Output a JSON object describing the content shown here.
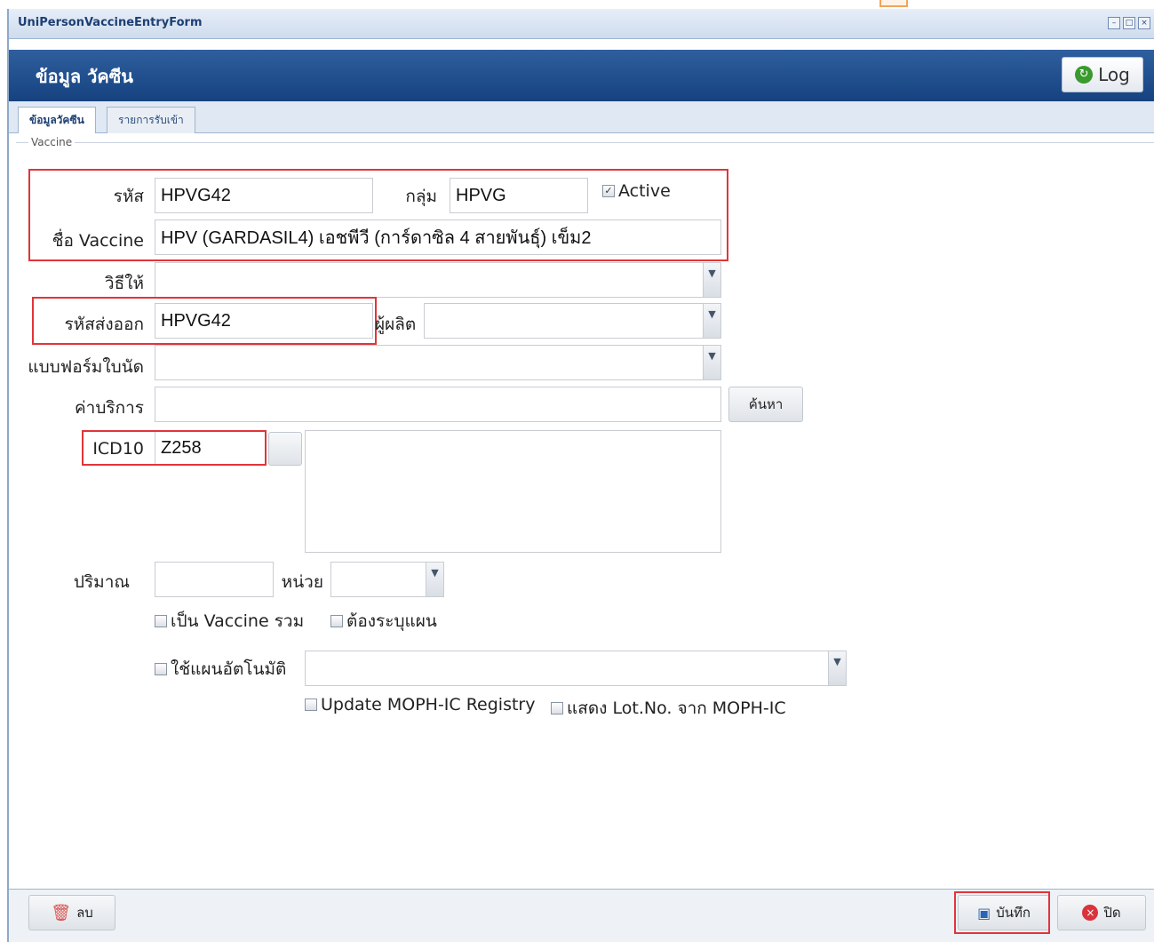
{
  "window": {
    "title": "UniPersonVaccineEntryForm"
  },
  "header": {
    "title": "ข้อมูล วัคซีน",
    "log_label": "Log"
  },
  "tabs": [
    {
      "label": "ข้อมูลวัคซีน"
    },
    {
      "label": "รายการรับเข้า"
    }
  ],
  "section": {
    "legend": "Vaccine"
  },
  "form": {
    "code_label": "รหัส",
    "code_value": "HPVG42",
    "group_label": "กลุ่ม",
    "group_value": "HPVG",
    "active_label": "Active",
    "active_checked": true,
    "name_label": "ชื่อ Vaccine",
    "name_value": "HPV (GARDASIL4) เอชพีวี (การ์ดาซิล 4 สายพันธุ์) เข็ม2",
    "method_label": "วิธีให้",
    "method_value": "",
    "export_code_label": "รหัสส่งออก",
    "export_code_value": "HPVG42",
    "manufacturer_label": "ผู้ผลิต",
    "manufacturer_value": "",
    "appointment_form_label": "แบบฟอร์มใบนัด",
    "appointment_form_value": "",
    "service_fee_label": "ค่าบริการ",
    "service_fee_value": "",
    "search_label": "ค้นหา",
    "icd10_label": "ICD10",
    "icd10_value": "Z258",
    "icd10_desc": "",
    "quantity_label": "ปริมาณ",
    "quantity_value": "",
    "unit_label": "หน่วย",
    "unit_value": "",
    "combined_vaccine_label": "เป็น Vaccine รวม",
    "require_plan_label": "ต้องระบุแผน",
    "auto_plan_label": "ใช้แผนอัตโนมัติ",
    "auto_plan_value": "",
    "update_moph_label": "Update MOPH-IC Registry",
    "show_lot_label": "แสดง Lot.No. จาก MOPH-IC"
  },
  "footer": {
    "delete_label": "ลบ",
    "save_label": "บันทึก",
    "close_label": "ปิด"
  },
  "colors": {
    "header": "#1f4f8f",
    "highlight": "#e0353a"
  }
}
